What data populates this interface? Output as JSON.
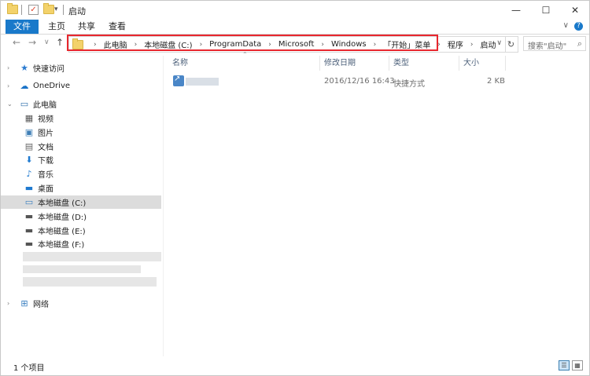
{
  "window": {
    "title": "启动",
    "controls": {
      "minimize": "—",
      "maximize": "☐",
      "close": "✕"
    }
  },
  "ribbon": {
    "tabs": [
      "文件",
      "主页",
      "共享",
      "查看"
    ],
    "toggle": "∨",
    "help": "?"
  },
  "nav": {
    "back": "←",
    "forward": "→",
    "recent": "∨",
    "up": "↑"
  },
  "address": {
    "breadcrumbs": [
      "此电脑",
      "本地磁盘 (C:)",
      "ProgramData",
      "Microsoft",
      "Windows",
      "「开始」菜单",
      "程序",
      "启动"
    ],
    "separator": "›",
    "dropdown": "∨",
    "refresh": "↻"
  },
  "search": {
    "placeholder": "搜索\"启动\"",
    "icon": "⌕"
  },
  "sidebar": {
    "items": [
      {
        "label": "快速访问",
        "icon": "star-icon",
        "glyph": "★",
        "color": "#2b7bd0"
      },
      {
        "label": "OneDrive",
        "icon": "cloud-icon",
        "glyph": "☁",
        "color": "#1a73c8"
      },
      {
        "label": "此电脑",
        "icon": "computer-icon",
        "glyph": "▭",
        "color": "#2f6fab"
      },
      {
        "label": "视频",
        "icon": "video-icon",
        "glyph": "▦",
        "color": "#555555"
      },
      {
        "label": "图片",
        "icon": "pictures-icon",
        "glyph": "▣",
        "color": "#3f7fb6"
      },
      {
        "label": "文档",
        "icon": "documents-icon",
        "glyph": "▤",
        "color": "#666666"
      },
      {
        "label": "下载",
        "icon": "download-icon",
        "glyph": "⬇",
        "color": "#1f7ad0"
      },
      {
        "label": "音乐",
        "icon": "music-icon",
        "glyph": "♪",
        "color": "#1f7ad0"
      },
      {
        "label": "桌面",
        "icon": "desktop-icon",
        "glyph": "▬",
        "color": "#1f7ad0"
      },
      {
        "label": "本地磁盘 (C:)",
        "icon": "drive-windows-icon",
        "glyph": "▭",
        "color": "#3a7fc0"
      },
      {
        "label": "本地磁盘 (D:)",
        "icon": "drive-icon",
        "glyph": "▬",
        "color": "#555555"
      },
      {
        "label": "本地磁盘 (E:)",
        "icon": "drive-icon",
        "glyph": "▬",
        "color": "#555555"
      },
      {
        "label": "本地磁盘 (F:)",
        "icon": "drive-icon",
        "glyph": "▬",
        "color": "#555555"
      },
      {
        "label": "网络",
        "icon": "network-icon",
        "glyph": "⊞",
        "color": "#3a7fc0"
      }
    ]
  },
  "columns": [
    "名称",
    "修改日期",
    "类型",
    "大小"
  ],
  "files": [
    {
      "date": "2016/12/16 16:43",
      "type": "快捷方式",
      "size": "2 KB"
    }
  ],
  "status": {
    "item_count": "1 个项目"
  },
  "view_buttons": {
    "details": "☰",
    "tiles": "▦"
  },
  "colors": {
    "accent": "#1979ca",
    "highlight_box": "#e8272e",
    "selected_bg": "#dcdcdc"
  }
}
